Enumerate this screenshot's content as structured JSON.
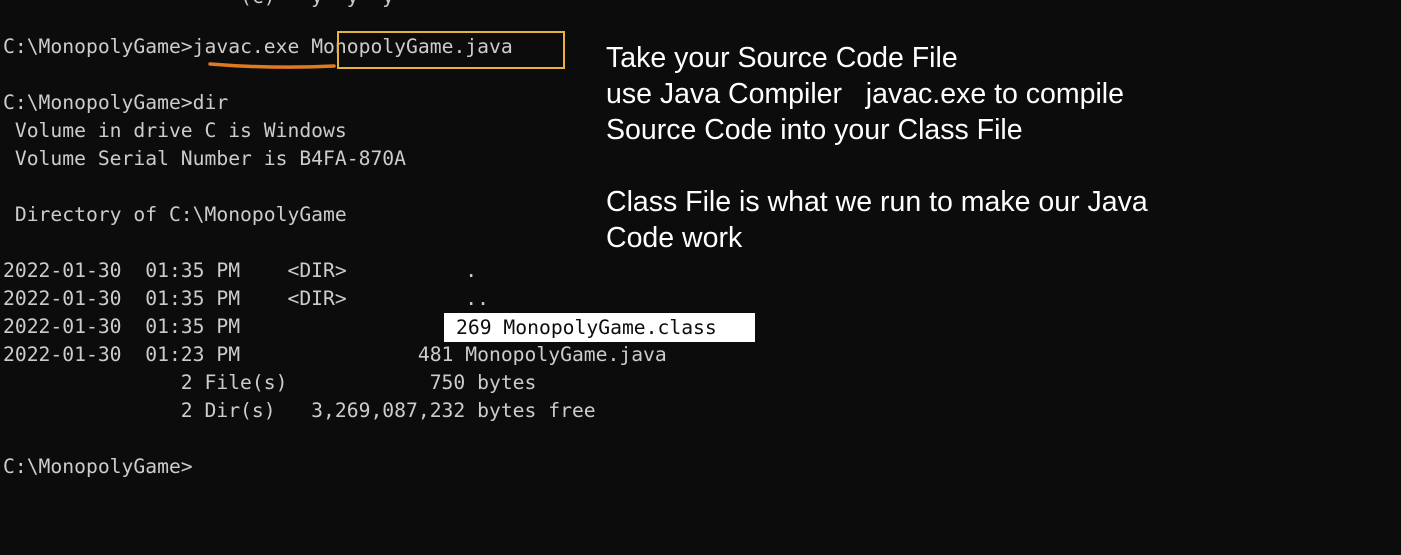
{
  "terminal": {
    "cut_line": "                    (C)   y  y  y",
    "prompt": "C:\\MonopolyGame>",
    "command": "javac.exe",
    "command_arg": "MonopolyGame.java",
    "dir_prompt": "C:\\MonopolyGame>dir",
    "volume_line": " Volume in drive C is Windows",
    "serial_line": " Volume Serial Number is B4FA-870A",
    "directory_line": " Directory of C:\\MonopolyGame",
    "listing": [
      "2022-01-30  01:35 PM    <DIR>          .",
      "2022-01-30  01:35 PM    <DIR>          ..",
      "2022-01-30  01:35 PM",
      "2022-01-30  01:23 PM               481 MonopolyGame.java"
    ],
    "highlighted_entry": "269 MonopolyGame.class",
    "files_summary": "               2 File(s)            750 bytes",
    "dirs_summary": "               2 Dir(s)   3,269,087,232 bytes free",
    "final_prompt": "C:\\MonopolyGame>"
  },
  "annotation": {
    "lines": [
      "Take your Source Code File",
      "use Java Compiler   javac.exe to compile",
      "Source Code into your Class File",
      "Class File is what we run to make our Java",
      "Code work"
    ]
  },
  "colors": {
    "background": "#0c0c0c",
    "terminal_text": "#cccccc",
    "box_outline": "#e6b43c",
    "underline": "#e07a1f",
    "annotation_text": "#ffffff",
    "highlight_bg": "#ffffff"
  }
}
